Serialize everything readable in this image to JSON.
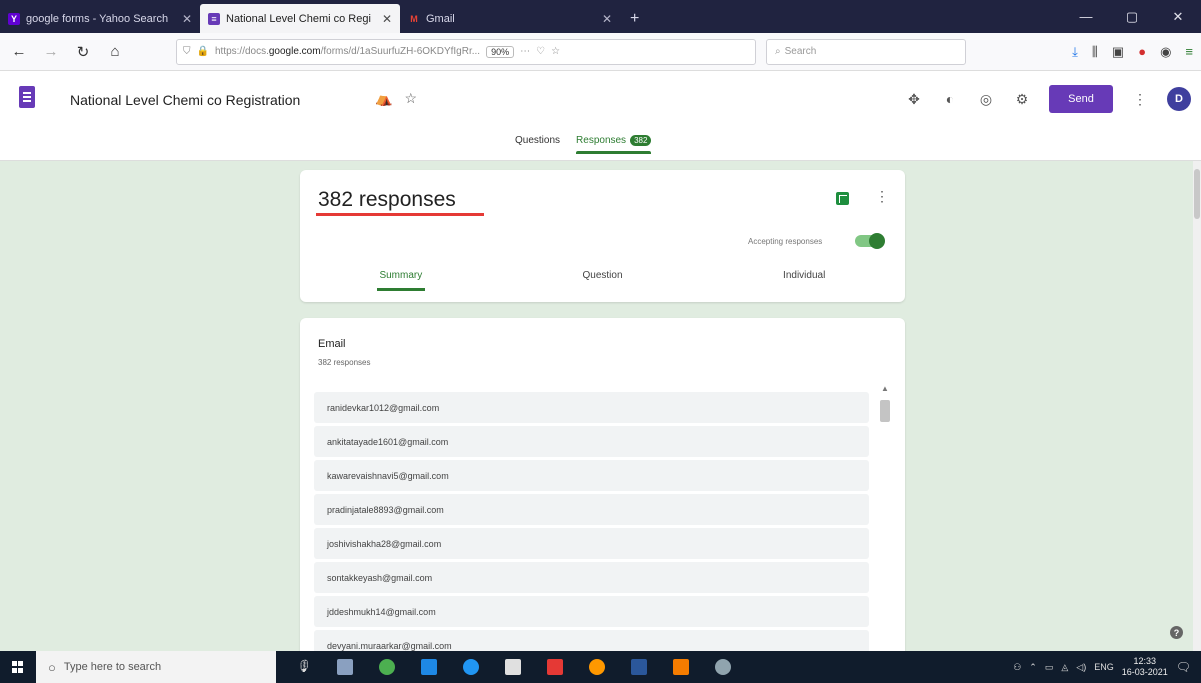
{
  "browser": {
    "tabs": [
      {
        "title": "google forms - Yahoo Search",
        "favicon": "Y",
        "color": "#6001d2"
      },
      {
        "title": "National Level Chemi co Regi",
        "favicon": "≡",
        "color": "#673ab7"
      },
      {
        "title": "Gmail",
        "favicon": "M",
        "color": "#ea4335"
      }
    ],
    "url_prefix": "https://docs.",
    "url_host": "google.com",
    "url_path": "/forms/d/1aSuurfuZH-6OKDYfIgRr...",
    "zoom": "90%",
    "search_placeholder": "Search"
  },
  "forms": {
    "title": "National Level Chemi co Registration",
    "send_label": "Send",
    "avatar_letter": "D",
    "nav_questions": "Questions",
    "nav_responses": "Responses",
    "nav_responses_count": "382"
  },
  "summary": {
    "count_text": "382 responses",
    "accepting_label": "Accepting responses",
    "tabs": [
      "Summary",
      "Question",
      "Individual"
    ]
  },
  "question": {
    "title": "Email",
    "subtitle": "382 responses",
    "answers": [
      "ranidevkar1012@gmail.com",
      "ankitatayade1601@gmail.com",
      "kawarevaishnavi5@gmail.com",
      "pradinjatale8893@gmail.com",
      "joshivishakha28@gmail.com",
      "sontakkeyash@gmail.com",
      "jddeshmukh14@gmail.com",
      "devyani.muraarkar@gmail.com"
    ]
  },
  "taskbar": {
    "search_placeholder": "Type here to search",
    "language": "ENG",
    "time": "12:33",
    "date": "16-03-2021"
  }
}
